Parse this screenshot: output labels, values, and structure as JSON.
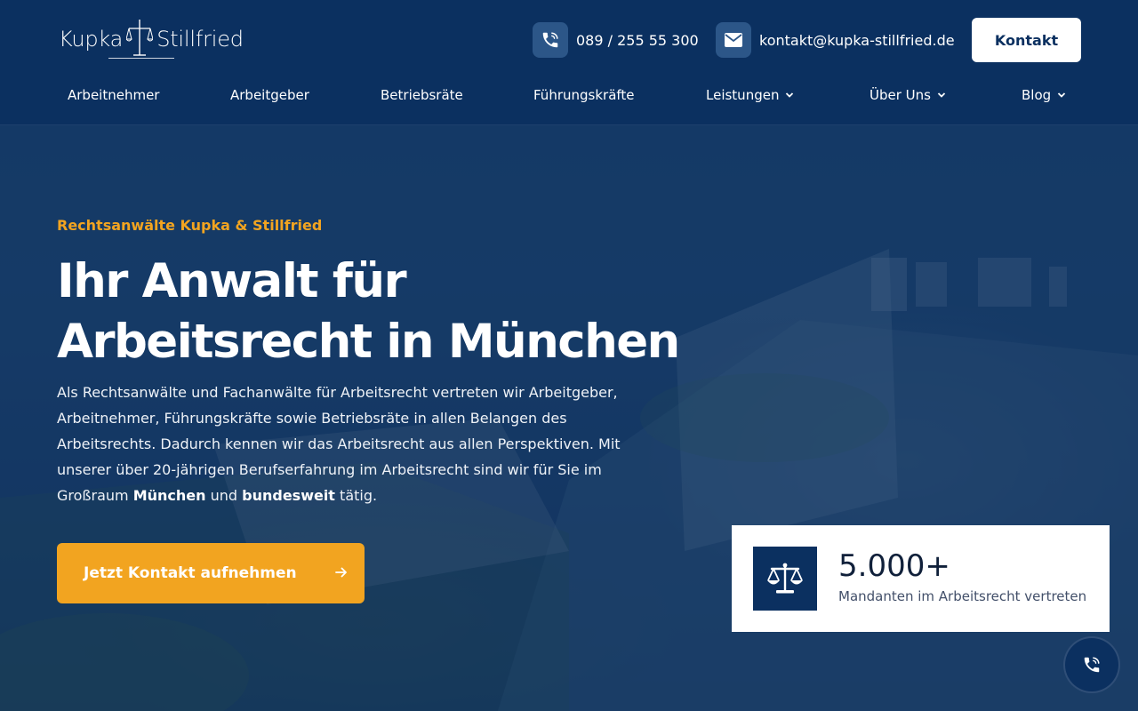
{
  "brand": {
    "logo_left": "Kupka",
    "logo_right": "Stillfried"
  },
  "header": {
    "phone_icon": "phone-icon",
    "phone": "089 / 255 55 300",
    "mail_icon": "envelope-icon",
    "email": "kontakt@kupka-stillfried.de",
    "contact_button": "Kontakt"
  },
  "nav": {
    "items": [
      {
        "label": "Arbeitnehmer"
      },
      {
        "label": "Arbeitgeber"
      },
      {
        "label": "Betriebsräte"
      },
      {
        "label": "Führungskräfte"
      },
      {
        "label": "Leistungen",
        "dropdown": true
      },
      {
        "label": "Über Uns",
        "dropdown": true
      },
      {
        "label": "Blog",
        "dropdown": true
      }
    ]
  },
  "hero": {
    "eyebrow": "Rechtsanwälte Kupka & Stillfried",
    "title": "Ihr Anwalt für Arbeitsrecht in München",
    "intro_start": "Als Rechtsanwälte und Fachanwälte für Arbeitsrecht vertreten wir Arbeitgeber, Arbeitnehmer, Führungskräfte sowie Betriebsräte in allen Belangen des Arbeitsrechts. Dadurch kennen wir das Arbeitsrecht aus allen Perspektiven. Mit unserer über 20-jährigen Berufserfahrung im Arbeitsrecht sind wir für Sie im Großraum ",
    "intro_bold1": "München",
    "intro_mid": " und ",
    "intro_bold2": "bundesweit",
    "intro_end": " tätig.",
    "cta_label": "Jetzt Kontakt aufnehmen",
    "cta_icon": "arrow-right-icon"
  },
  "stat": {
    "icon": "scales-icon",
    "value": "5.000+",
    "label": "Mandanten im Arbeitsrecht vertreten"
  },
  "floating_call": {
    "icon": "phone-call-icon"
  },
  "colors": {
    "navy": "#0b3060",
    "accent": "#f2a420",
    "icon_bg": "#2c5688"
  }
}
